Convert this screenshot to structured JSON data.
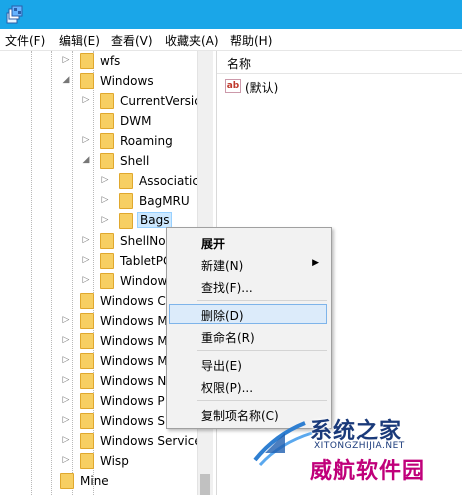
{
  "app": {
    "icon": "regedit-icon",
    "title_bar_color": "#1aa6e8"
  },
  "menubar": [
    "文件(F)",
    "编辑(E)",
    "查看(V)",
    "收藏夹(A)",
    "帮助(H)"
  ],
  "tree": {
    "nodes": [
      {
        "label": "wfs",
        "expanded": false,
        "hasChildren": true
      },
      {
        "label": "Windows",
        "expanded": true,
        "hasChildren": true
      },
      {
        "label": "CurrentVersic",
        "expanded": false,
        "hasChildren": true
      },
      {
        "label": "DWM",
        "expanded": false,
        "hasChildren": false
      },
      {
        "label": "Roaming",
        "expanded": false,
        "hasChildren": true
      },
      {
        "label": "Shell",
        "expanded": true,
        "hasChildren": true
      },
      {
        "label": "Associatic",
        "expanded": false,
        "hasChildren": true
      },
      {
        "label": "BagMRU",
        "expanded": false,
        "hasChildren": true
      },
      {
        "label": "Bags",
        "expanded": false,
        "hasChildren": true,
        "selected": true
      },
      {
        "label": "ShellNo",
        "expanded": false,
        "hasChildren": true
      },
      {
        "label": "TabletPC",
        "expanded": false,
        "hasChildren": true
      },
      {
        "label": "Window",
        "expanded": false,
        "hasChildren": true
      },
      {
        "label": "Windows C",
        "expanded": false,
        "hasChildren": false
      },
      {
        "label": "Windows M",
        "expanded": false,
        "hasChildren": true
      },
      {
        "label": "Windows M",
        "expanded": false,
        "hasChildren": true
      },
      {
        "label": "Windows M",
        "expanded": false,
        "hasChildren": true
      },
      {
        "label": "Windows N",
        "expanded": false,
        "hasChildren": true
      },
      {
        "label": "Windows P",
        "expanded": false,
        "hasChildren": true
      },
      {
        "label": "Windows S",
        "expanded": false,
        "hasChildren": true
      },
      {
        "label": "Windows Service",
        "expanded": false,
        "hasChildren": true
      },
      {
        "label": "Wisp",
        "expanded": false,
        "hasChildren": true
      },
      {
        "label": "Mine",
        "expanded": false,
        "hasChildren": false
      }
    ]
  },
  "values": {
    "column_name": "名称",
    "rows": [
      {
        "icon": "string-value-icon",
        "icon_text": "ab",
        "name": "(默认)"
      }
    ]
  },
  "context_menu": [
    {
      "label": "展开",
      "bold": true
    },
    {
      "label": "新建(N)",
      "submenu": true
    },
    {
      "label": "查找(F)..."
    },
    {
      "separator": true
    },
    {
      "label": "删除(D)",
      "highlighted": true
    },
    {
      "label": "重命名(R)"
    },
    {
      "separator": true
    },
    {
      "label": "导出(E)"
    },
    {
      "label": "权限(P)..."
    },
    {
      "separator": true
    },
    {
      "label": "复制项名称(C)"
    }
  ],
  "watermark": {
    "line1": "系统之家",
    "line2": "XITONGZHIJIA.NET",
    "line3": "威航软件园"
  }
}
